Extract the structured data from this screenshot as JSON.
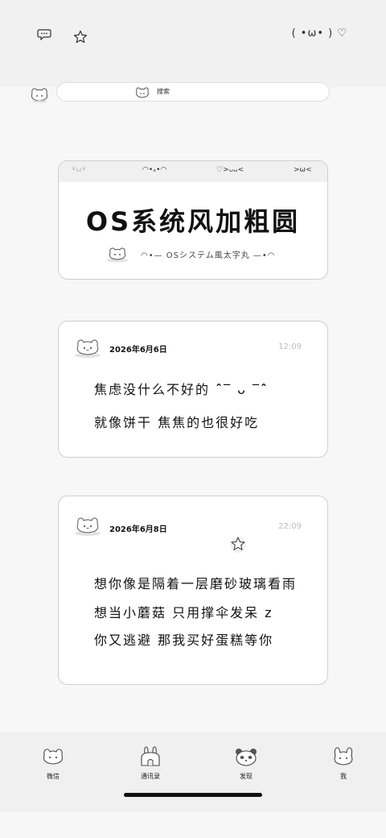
{
  "header": {
    "icons": [
      "chat-bubble-icon",
      "star-icon"
    ],
    "kaomoji": "( •ω• ) ♡"
  },
  "search": {
    "label": "搜索"
  },
  "banner": {
    "strip": [
      "•᷄ω•᷅",
      "◠•ₓ•◠",
      "♡>ᴗᴗ<",
      ">ω<"
    ],
    "title": "OS系统风加粗圆",
    "subtitle": "◠•— OSシステム風太字丸 —•◠"
  },
  "posts": [
    {
      "date": "2026年6月6日",
      "time": "12:09",
      "lines": [
        "焦虑没什么不好的 ˆ̑‾ ᴗ ‾ˆ̑",
        "就像饼干 焦焦的也很好吃"
      ]
    },
    {
      "date": "2026年6月8日",
      "time": "22:09",
      "lines": [
        "想你像是隔着一层磨砂玻璃看雨",
        "想当小蘑菇 只用撑伞发呆   z",
        "你又逃避 那我买好蛋糕等你"
      ]
    }
  ],
  "tabs": [
    {
      "label": "微信",
      "icon": "bear-icon"
    },
    {
      "label": "通讯录",
      "icon": "bunny-house-icon"
    },
    {
      "label": "发现",
      "icon": "panda-icon"
    },
    {
      "label": "我",
      "icon": "bunny-icon"
    }
  ]
}
